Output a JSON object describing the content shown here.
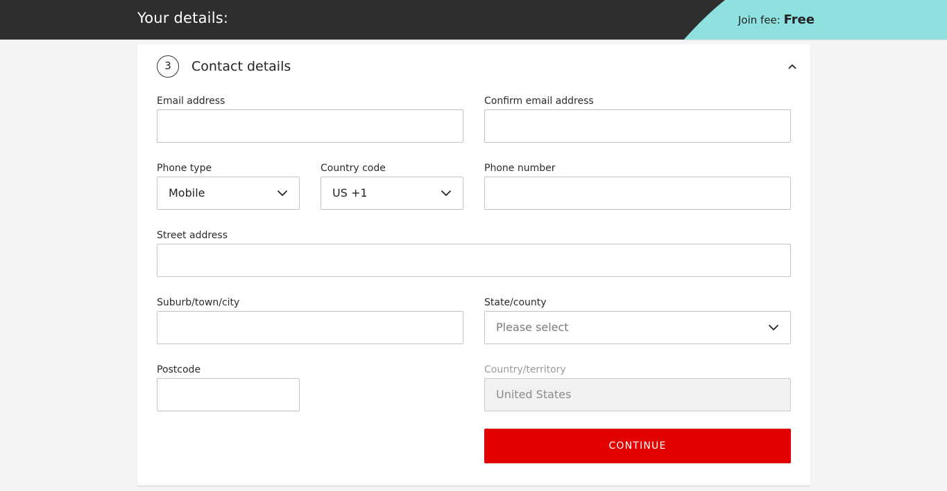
{
  "header": {
    "title": "Your details:",
    "fee_label": "Join fee:",
    "fee_value": "Free",
    "bar_color": "#2e2e2e",
    "accent_color": "#8fe1e0"
  },
  "section": {
    "step_number": "3",
    "title": "Contact details",
    "collapse_icon": "chevron-up-icon"
  },
  "form": {
    "email": {
      "label": "Email address",
      "value": ""
    },
    "confirm_email": {
      "label": "Confirm email address",
      "value": ""
    },
    "phone_type": {
      "label": "Phone type",
      "value": "Mobile"
    },
    "country_code": {
      "label": "Country code",
      "value": "US +1"
    },
    "phone_number": {
      "label": "Phone number",
      "value": ""
    },
    "street": {
      "label": "Street address",
      "value": ""
    },
    "suburb": {
      "label": "Suburb/town/city",
      "value": ""
    },
    "state": {
      "label": "State/county",
      "placeholder": "Please select"
    },
    "postcode": {
      "label": "Postcode",
      "value": ""
    },
    "country": {
      "label": "Country/territory",
      "value": "United States"
    }
  },
  "actions": {
    "continue_label": "CONTINUE",
    "continue_color": "#e30000"
  }
}
